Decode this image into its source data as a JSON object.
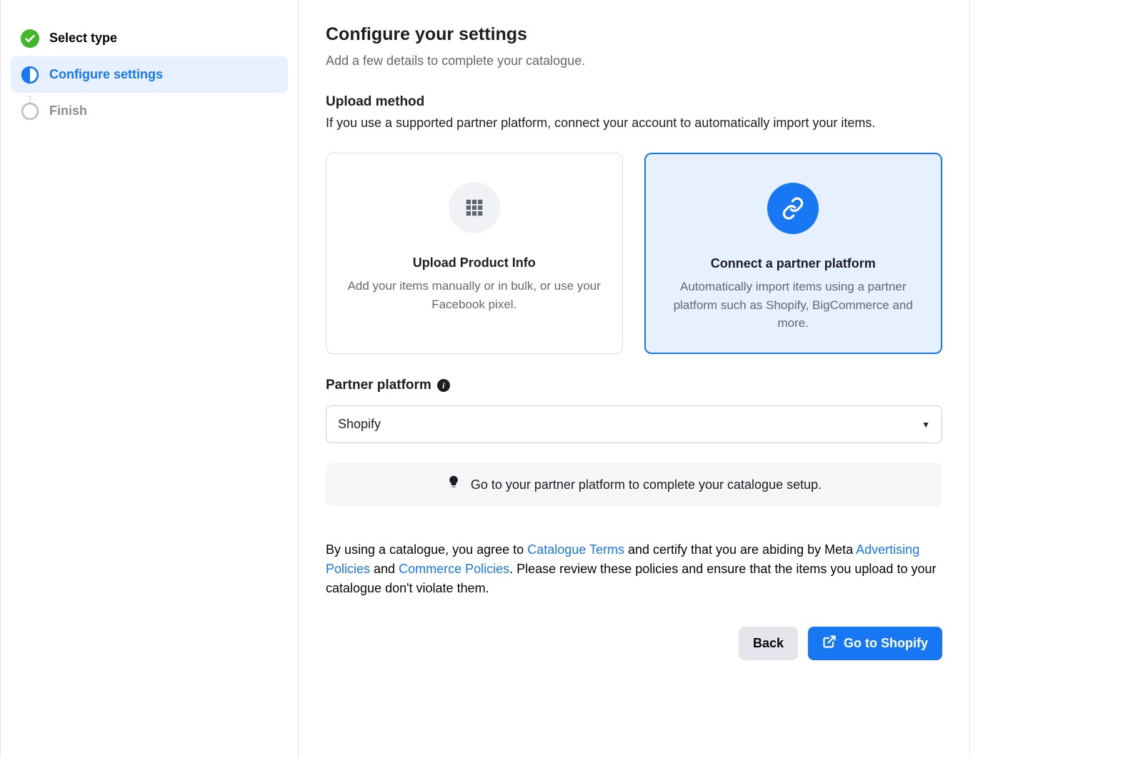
{
  "sidebar": {
    "steps": [
      {
        "label": "Select type"
      },
      {
        "label": "Configure settings"
      },
      {
        "label": "Finish"
      }
    ]
  },
  "main": {
    "heading": "Configure your settings",
    "subheading": "Add a few details to complete your catalogue.",
    "upload_method": {
      "label": "Upload method",
      "desc": "If you use a supported partner platform, connect your account to automatically import your items."
    },
    "cards": {
      "upload": {
        "title": "Upload Product Info",
        "desc": "Add your items manually or in bulk, or use your Facebook pixel."
      },
      "partner": {
        "title": "Connect a partner platform",
        "desc": "Automatically import items using a partner platform such as Shopify, BigCommerce and more."
      }
    },
    "partner_platform": {
      "label": "Partner platform",
      "selected": "Shopify"
    },
    "hint": "Go to your partner platform to complete your catalogue setup.",
    "legal": {
      "pre": "By using a catalogue, you agree to ",
      "link1": "Catalogue Terms",
      "mid1": " and certify that you are abiding by Meta ",
      "link2": "Advertising Policies",
      "mid2": " and ",
      "link3": "Commerce Policies",
      "post": ". Please review these policies and ensure that the items you upload to your catalogue don't violate them."
    },
    "buttons": {
      "back": "Back",
      "primary": "Go to Shopify"
    }
  }
}
